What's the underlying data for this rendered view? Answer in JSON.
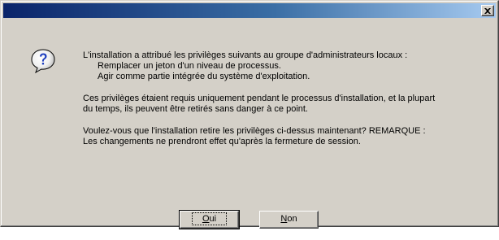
{
  "window": {
    "title": ""
  },
  "message": {
    "line1": "L'installation a attribué les privilèges suivants au groupe d'administrateurs locaux :",
    "privileges": [
      "Remplacer un jeton d'un niveau de processus.",
      "Agir comme partie intégrée du système d'exploitation."
    ],
    "paragraph2_line1": "Ces privilèges étaient requis uniquement pendant le processus d'installation, et la plupart",
    "paragraph2_line2": "du temps, ils peuvent être retirés sans danger à ce point.",
    "paragraph3_line1": "Voulez-vous que l'installation retire les privilèges ci-dessus maintenant?  REMARQUE :",
    "paragraph3_line2": "Les changements ne prendront effet qu'après la fermeture de session."
  },
  "buttons": {
    "yes_accel": "O",
    "yes_rest": "ui",
    "no_accel": "N",
    "no_rest": "on"
  },
  "icons": {
    "question": "question-icon",
    "close": "close-icon"
  },
  "colors": {
    "title_start": "#0a246a",
    "title_end": "#a6caf0",
    "face": "#d4d0c8"
  }
}
